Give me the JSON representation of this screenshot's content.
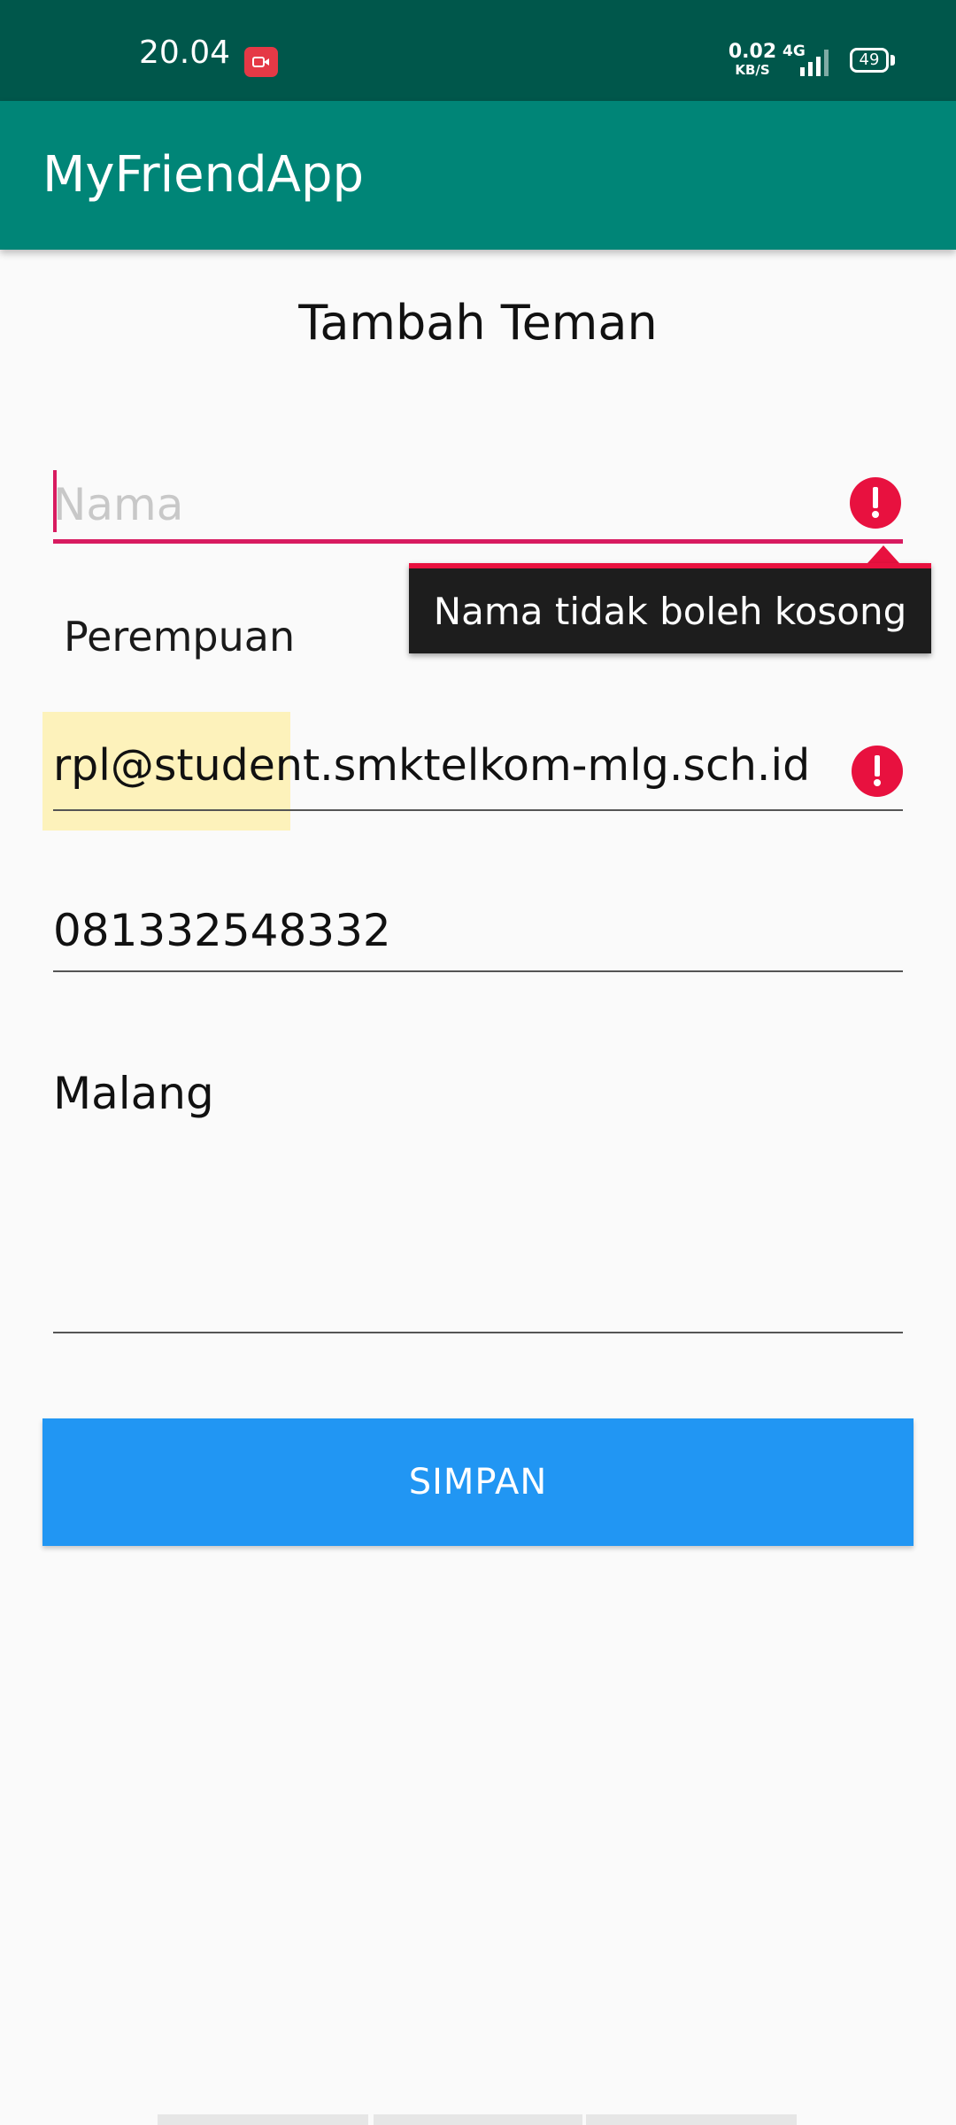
{
  "status_bar": {
    "time": "20.04",
    "net_speed_value": "0.02",
    "net_speed_unit": "KB/S",
    "network_type": "4G",
    "battery": "49",
    "recording_icon": "screen-record-icon",
    "signal_icon": "signal-icon"
  },
  "app_bar": {
    "title": "MyFriendApp"
  },
  "form": {
    "title": "Tambah Teman",
    "nama": {
      "placeholder": "Nama",
      "value": "",
      "error": "Nama tidak boleh kosong"
    },
    "gender": {
      "selected": "Perempuan"
    },
    "email": {
      "value": "rpl@student.smktelkom-mlg.sch.id"
    },
    "phone": {
      "value": "081332548332"
    },
    "address": {
      "value": "Malang"
    },
    "submit_label": "SIMPAN"
  },
  "colors": {
    "status_bar": "#00574b",
    "app_bar": "#008577",
    "accent": "#d81b60",
    "error": "#e8113f",
    "button": "#2196f3"
  }
}
